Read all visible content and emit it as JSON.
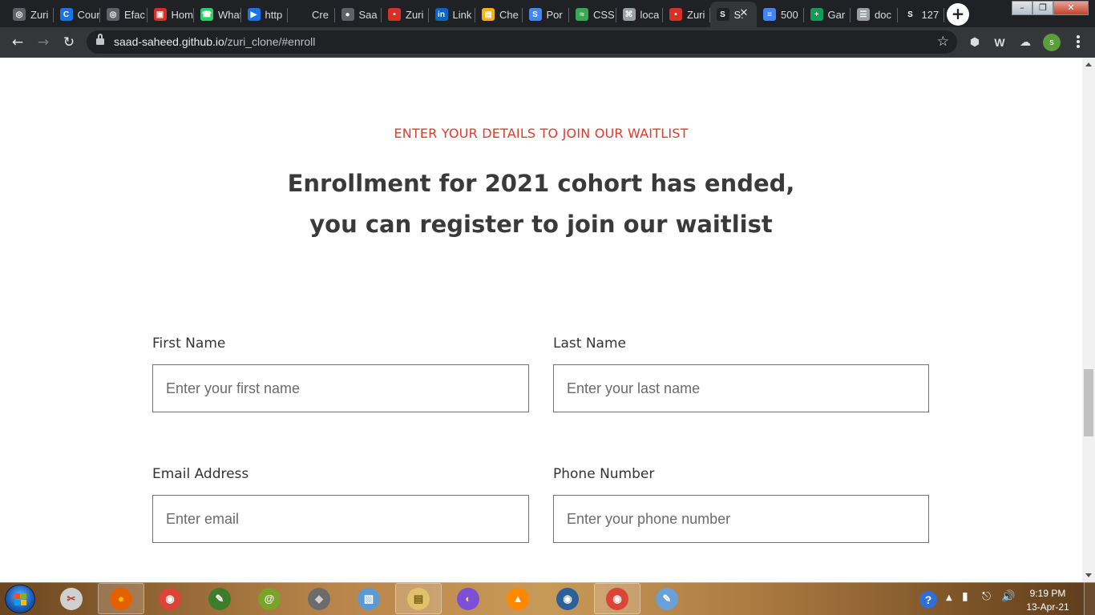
{
  "browser": {
    "tabs": [
      {
        "title": "Zuri",
        "favicon": "globe-icon",
        "color": "#5f6368"
      },
      {
        "title": "Course",
        "favicon": "c-logo-icon",
        "color": "#1a73e8"
      },
      {
        "title": "Efac",
        "favicon": "globe-icon",
        "color": "#5f6368"
      },
      {
        "title": "Home",
        "favicon": "brand-red-icon",
        "color": "#d93025"
      },
      {
        "title": "WhatsApp",
        "favicon": "whatsapp-icon",
        "color": "#25d366"
      },
      {
        "title": "http",
        "favicon": "play-icon",
        "color": "#1a73e8"
      },
      {
        "title": "Cre",
        "favicon": "blank-icon",
        "color": "#202124"
      },
      {
        "title": "Saa",
        "favicon": "github-icon",
        "color": "#5f6368"
      },
      {
        "title": "Zuri",
        "favicon": "dot-icon",
        "color": "#d93025"
      },
      {
        "title": "Link",
        "favicon": "linkedin-icon",
        "color": "#0a66c2"
      },
      {
        "title": "Che",
        "favicon": "gift-icon",
        "color": "#f4b400"
      },
      {
        "title": "Por",
        "favicon": "s-logo-icon",
        "color": "#4285f4"
      },
      {
        "title": "CSS",
        "favicon": "chart-icon",
        "color": "#34a853"
      },
      {
        "title": "loca",
        "favicon": "puzzle-icon",
        "color": "#9aa0a6"
      },
      {
        "title": "Zuri",
        "favicon": "dot-icon",
        "color": "#d93025"
      },
      {
        "title": "S.",
        "favicon": "s-dot-icon",
        "color": "#202124"
      },
      {
        "title": "500",
        "favicon": "docs-icon",
        "color": "#4285f4"
      },
      {
        "title": "Gar",
        "favicon": "sheets-icon",
        "color": "#0f9d58"
      },
      {
        "title": "doc",
        "favicon": "list-icon",
        "color": "#9aa0a6"
      },
      {
        "title": "127",
        "favicon": "s-dot-icon",
        "color": "#202124"
      }
    ],
    "active_tab_index": 15,
    "url_host": "saad-saheed.github.io",
    "url_path": "/zuri_clone/#enroll",
    "profile_initial": "s"
  },
  "page": {
    "eyebrow": "ENTER YOUR DETAILS TO JOIN OUR WAITLIST",
    "headline_line1": "Enrollment for 2021 cohort has ended,",
    "headline_line2": "you can register to join our waitlist",
    "accent_color": "#e03a2f",
    "form": {
      "first_name_label": "First Name",
      "first_name_placeholder": "Enter your first name",
      "last_name_label": "Last Name",
      "last_name_placeholder": "Enter your last name",
      "email_label": "Email Address",
      "email_placeholder": "Enter email",
      "phone_label": "Phone Number",
      "phone_placeholder": "Enter your phone number"
    }
  },
  "taskbar": {
    "apps": [
      "snipping-tool-icon",
      "firefox-icon",
      "chrome-icon",
      "paint-net-icon",
      "spiral-icon",
      "grenade-icon",
      "box-icon",
      "file-explorer-icon",
      "vpn-icon",
      "vlc-icon",
      "anki-icon",
      "chrome-icon",
      "paint-icon"
    ],
    "clock_time": "9:19 PM",
    "clock_date": "13-Apr-21"
  }
}
